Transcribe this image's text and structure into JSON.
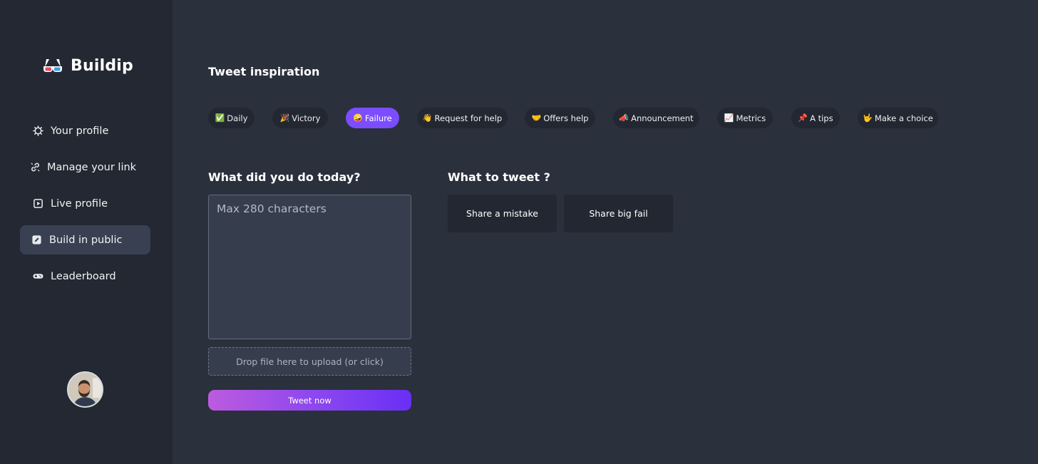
{
  "brand": {
    "name": "Buildip",
    "icon": "3d-glasses-icon"
  },
  "sidebar": {
    "items": [
      {
        "label": "Your profile",
        "icon": "gear-icon",
        "active": false
      },
      {
        "label": "Manage your link",
        "icon": "link-icon",
        "active": false
      },
      {
        "label": "Live profile",
        "icon": "play-icon",
        "active": false
      },
      {
        "label": "Build in public",
        "icon": "edit-icon",
        "active": true
      },
      {
        "label": "Leaderboard",
        "icon": "gamepad-icon",
        "active": false
      }
    ],
    "avatar": "user-avatar"
  },
  "inspiration": {
    "title": "Tweet inspiration",
    "chips": [
      {
        "emoji": "✅",
        "label": "Daily",
        "active": false
      },
      {
        "emoji": "🎉",
        "label": "Victory",
        "active": false
      },
      {
        "emoji": "🤪",
        "label": "Failure",
        "active": true
      },
      {
        "emoji": "👋",
        "label": "Request for help",
        "active": false
      },
      {
        "emoji": "🤝",
        "label": "Offers help",
        "active": false
      },
      {
        "emoji": "📣",
        "label": "Announcement",
        "active": false
      },
      {
        "emoji": "📈",
        "label": "Metrics",
        "active": false
      },
      {
        "emoji": "📌",
        "label": "A tips",
        "active": false
      },
      {
        "emoji": "🤟",
        "label": "Make a choice",
        "active": false
      }
    ]
  },
  "compose": {
    "title": "What did you do today?",
    "placeholder": "Max 280 characters",
    "value": "",
    "dropzone": "Drop file here to upload (or click)",
    "button": "Tweet now"
  },
  "suggestions": {
    "title": "What to tweet ?",
    "items": [
      "Share a mistake",
      "Share big fail"
    ]
  },
  "colors": {
    "background": "#2a303c",
    "sidebar": "#232832",
    "accent": "#7b4dff",
    "chip": "#222731",
    "input": "#363d4d"
  }
}
